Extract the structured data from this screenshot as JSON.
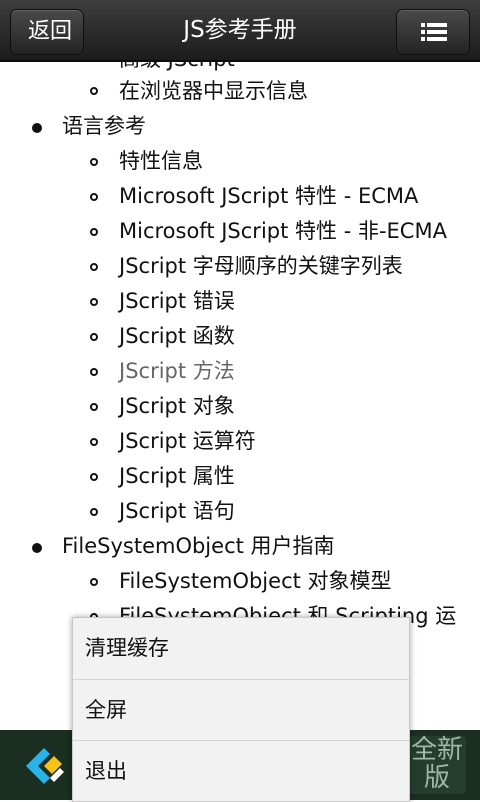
{
  "header": {
    "back_label": "返回",
    "title": "JS参考手册",
    "menu_icon": "list-menu-icon"
  },
  "content": {
    "partial_top_item": "高级 JScript",
    "items": [
      {
        "level": 2,
        "label": "在浏览器中显示信息"
      },
      {
        "level": 1,
        "label": "语言参考"
      },
      {
        "level": 2,
        "label": "特性信息"
      },
      {
        "level": 2,
        "label": "Microsoft JScript 特性 - ECMA"
      },
      {
        "level": 2,
        "label": "Microsoft JScript 特性 - 非-ECMA"
      },
      {
        "level": 2,
        "label": "JScript 字母顺序的关键字列表"
      },
      {
        "level": 2,
        "label": "JScript 错误"
      },
      {
        "level": 2,
        "label": "JScript 函数"
      },
      {
        "level": 2,
        "label": "JScript 方法"
      },
      {
        "level": 2,
        "label": "JScript 对象"
      },
      {
        "level": 2,
        "label": "JScript 运算符"
      },
      {
        "level": 2,
        "label": "JScript 属性"
      },
      {
        "level": 2,
        "label": "JScript 语句"
      },
      {
        "level": 1,
        "label": "FileSystemObject 用户指南"
      },
      {
        "level": 2,
        "label": "FileSystemObject 对象模型"
      },
      {
        "level": 2,
        "label": "FileSystemObject 和 Scripting 运"
      }
    ]
  },
  "popup_menu": {
    "items": [
      "清理缓存",
      "全屏",
      "退出"
    ]
  },
  "banner": {
    "badge_text": "全新版"
  },
  "colors": {
    "topbar": "#2a2a2a",
    "text": "#111111",
    "popup_bg": "#f2f2f2",
    "banner_bg": "#1a2e22"
  }
}
